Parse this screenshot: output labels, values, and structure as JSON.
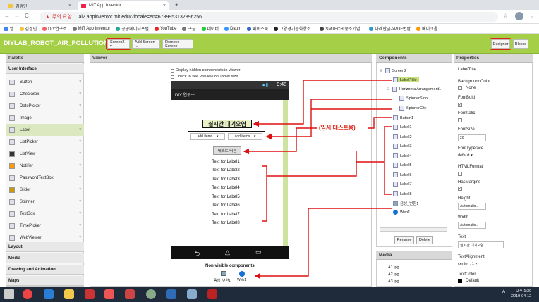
{
  "browser": {
    "tabs": [
      {
        "label": "김경민"
      },
      {
        "label": "MIT App Inventor"
      }
    ],
    "new_tab": "+",
    "nav": {
      "back": "←",
      "forward": "→",
      "reload": "C"
    },
    "address": {
      "warning": "주의 요함",
      "url": "ai2.appinventor.mit.edu/?locale=en#6739953132896256"
    },
    "bookmarks": [
      "앱",
      "김경민",
      "DIY연구소",
      "MIT App Inventor",
      "공공데이터포털",
      "YouTube",
      "구글",
      "네이버",
      "Daum",
      "페이스북",
      "고양경기문화창조...",
      "SMTECH 중소기업...",
      "아래한글->PDF변환",
      "메이크올"
    ]
  },
  "app": {
    "project_name": "DIYLAB_ROBOT_AIR_POLLUTION1",
    "screen_select": "Screen2 ▾",
    "add_screen": "Add Screen ...",
    "remove_screen": "Remove Screen",
    "designer": "Designer",
    "blocks": "Blocks"
  },
  "palette": {
    "title": "Palette",
    "section": "User Interface",
    "items": [
      "Button",
      "CheckBox",
      "DatePicker",
      "Image",
      "Label",
      "ListPicker",
      "ListView",
      "Notifier",
      "PasswordTextBox",
      "Slider",
      "Spinner",
      "TextBox",
      "TimePicker",
      "WebViewer"
    ],
    "help": "?",
    "other_sections": [
      "Layout",
      "Media",
      "Drawing and Animation",
      "Maps"
    ]
  },
  "viewer": {
    "title": "Viewer",
    "opt_hidden": "Display hidden components in Viewer",
    "opt_tablet": "Check to see Preview on Tablet size.",
    "status_time": "9:48",
    "app_title": "DIY 연구소",
    "label_title": "실시간 대기오염",
    "spinner1": "add items... ▾",
    "spinner2": "add items... ▾",
    "button": "테스트 버튼",
    "labels": [
      "Text for Label1",
      "Text for Label2",
      "Text for Label3",
      "Text for Label4",
      "Text for Label5",
      "Text for Label6",
      "Text for Label7",
      "Text for Label8"
    ],
    "nonvisible_title": "Non-visible components",
    "nonvisible": [
      "음성_변환1",
      "Web1"
    ],
    "annotation": "(임시 테스트용)"
  },
  "components": {
    "title": "Components",
    "tree": [
      "Screen2",
      "LabelTitle",
      "HorizontalArrangement1",
      "SpinnerSido",
      "SpinnerCity",
      "Button1",
      "Label1",
      "Label2",
      "Label3",
      "Label4",
      "Label5",
      "Label6",
      "Label7",
      "Label8",
      "음성_변환1",
      "Web1"
    ],
    "rename": "Rename",
    "delete": "Delete"
  },
  "media": {
    "title": "Media",
    "files": [
      "A1.jpg",
      "A2.jpg",
      "A3.jpg"
    ]
  },
  "properties": {
    "title": "Properties",
    "component": "LabelTitle",
    "bg_color_label": "BackgroundColor",
    "bg_color_value": "None",
    "font_bold": "FontBold",
    "font_italic": "FontItalic",
    "font_size": "FontSize",
    "font_size_value": "20",
    "font_typeface": "FontTypeface",
    "font_typeface_value": "default ▾",
    "html_format": "HTMLFormat",
    "has_margins": "HasMargins",
    "height": "Height",
    "height_value": "Automatic...",
    "width": "Width",
    "width_value": "Automatic...",
    "text": "Text",
    "text_value": "실시간 대기오염",
    "text_alignment": "TextAlignment",
    "text_alignment_value": "center : 1 ▾",
    "text_color": "TextColor",
    "text_color_value": "Default"
  },
  "taskbar": {
    "time": "오후 1:30",
    "date": "2019-04-12",
    "lang": "A"
  },
  "colors": {
    "accent_green": "#a5cf47",
    "highlight_red": "#d21111"
  }
}
